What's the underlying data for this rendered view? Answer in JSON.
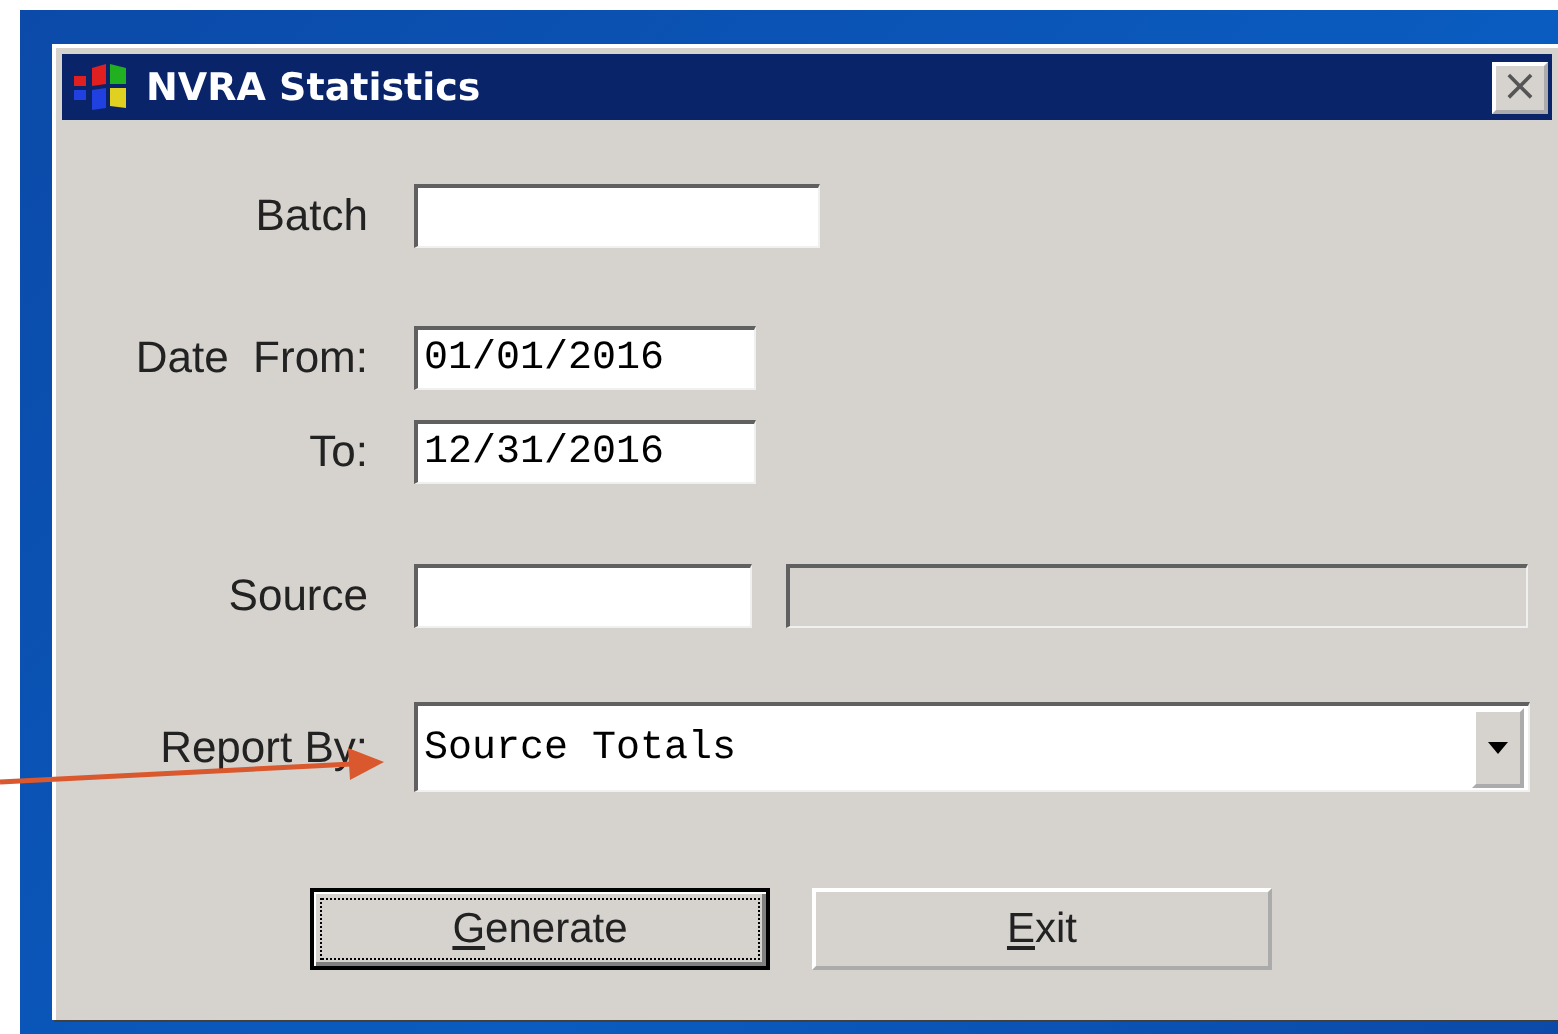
{
  "window": {
    "title": "NVRA Statistics",
    "close": "×"
  },
  "fields": [
    {
      "kind": "text",
      "label": "Batch"
    },
    {
      "kind": "text",
      "label": "Date  From:",
      "value": "01/01/2016"
    },
    {
      "kind": "text",
      "label": "To:",
      "value": "12/31/2016"
    },
    {
      "kind": "pair",
      "label": "Source"
    },
    {
      "kind": "combo",
      "label": "Report By:",
      "value": "Source Totals"
    }
  ],
  "buttons": [
    {
      "label": "Generate",
      "underline_first": true,
      "focused": true
    },
    {
      "label": "Exit",
      "underline_first": true,
      "focused": false
    }
  ],
  "annotation": {
    "kind": "arrow"
  }
}
